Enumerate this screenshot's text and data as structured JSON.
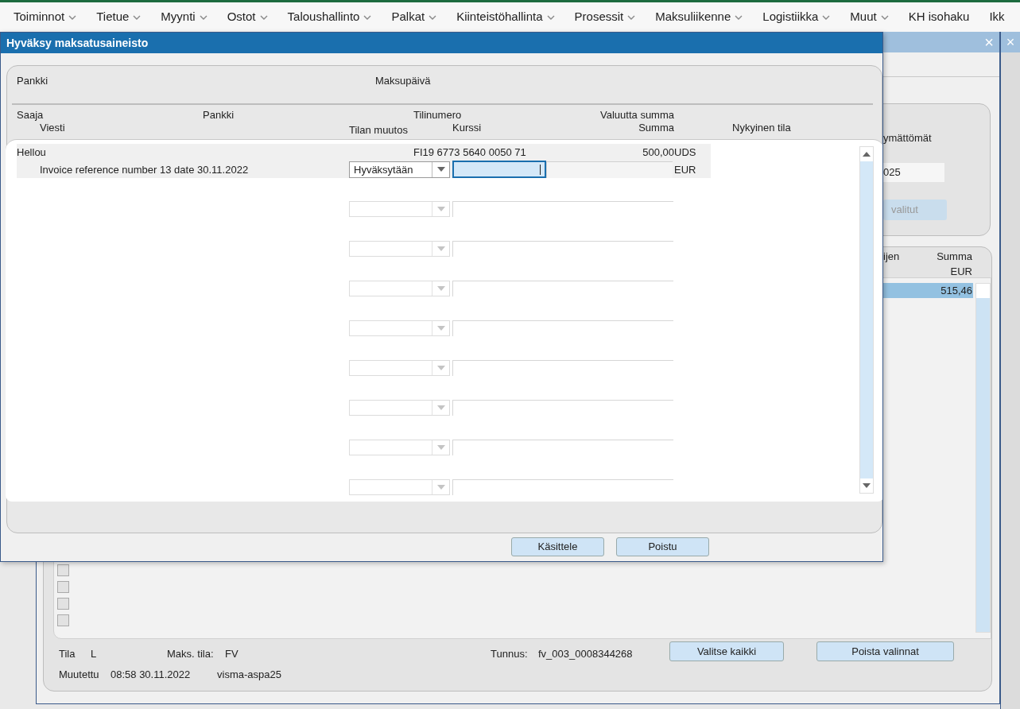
{
  "menu": [
    {
      "label": "Toiminnot",
      "has_dropdown": true
    },
    {
      "label": "Tietue",
      "has_dropdown": true
    },
    {
      "label": "Myynti",
      "has_dropdown": true
    },
    {
      "label": "Ostot",
      "has_dropdown": true
    },
    {
      "label": "Taloushallinto",
      "has_dropdown": true
    },
    {
      "label": "Palkat",
      "has_dropdown": true
    },
    {
      "label": "Kiinteistöhallinta",
      "has_dropdown": true
    },
    {
      "label": "Prosessit",
      "has_dropdown": true
    },
    {
      "label": "Maksuliikenne",
      "has_dropdown": true
    },
    {
      "label": "Logistiikka",
      "has_dropdown": true
    },
    {
      "label": "Muut",
      "has_dropdown": true
    },
    {
      "label": "KH isohaku",
      "has_dropdown": false
    },
    {
      "label": "Ikk",
      "has_dropdown": false
    }
  ],
  "side_window": {
    "close_label": "×"
  },
  "background_window": {
    "close_label": "×",
    "side_panel": {
      "label": "ymättömät",
      "field_value": "025",
      "button": {
        "label": "valitut",
        "disabled": true
      }
    },
    "list": {
      "columns": [
        {
          "label": "ijen"
        },
        {
          "label": "Summa",
          "unit": "EUR"
        }
      ],
      "rows": [
        {
          "summa": "515,46",
          "selected": true
        }
      ],
      "checkboxes": [
        {
          "checked": false
        },
        {
          "checked": false
        },
        {
          "checked": false
        },
        {
          "checked": false
        }
      ]
    },
    "footer": {
      "tila_label": "Tila",
      "tila": "L",
      "maks_tila_label": "Maks. tila:",
      "maks_tila": "FV",
      "tunnus_label": "Tunnus:",
      "tunnus": "fv_003_0008344268",
      "muutettu_label": "Muutettu",
      "muutettu": "08:58 30.11.2022",
      "user": "visma-aspa25"
    },
    "buttons": [
      {
        "label": "Valitse kaikki"
      },
      {
        "label": "Poista valinnat"
      }
    ]
  },
  "dialog": {
    "title": "Hyväksy maksatusaineisto",
    "header_labels": [
      "Pankki",
      "Maksupäivä"
    ],
    "columns": {
      "saaja": "Saaja",
      "pankki": "Pankki",
      "tilinumero": "Tilinumero",
      "valuutta_summa": "Valuutta summa",
      "viesti": "Viesti",
      "tilan_muutos": "Tilan muutos",
      "kurssi": "Kurssi",
      "summa": "Summa",
      "nykyinen_tila": "Nykyinen tila"
    },
    "rows": [
      {
        "kind": "entry",
        "saaja": "Hellou",
        "tilinumero": "FI19 6773 5640 0050 71",
        "valuutta_summa": "500,00",
        "valuutta": "UDS",
        "viesti": "Invoice reference number 13 date 30.11.2022",
        "tilan_muutos": "Hyväksytään",
        "kurssi_focused": true,
        "summa_valuutta": "EUR"
      },
      {
        "kind": "blank",
        "disabled": true
      },
      {
        "kind": "blank",
        "disabled": true
      },
      {
        "kind": "blank",
        "disabled": true
      },
      {
        "kind": "blank",
        "disabled": true
      },
      {
        "kind": "blank",
        "disabled": true
      },
      {
        "kind": "blank",
        "disabled": true
      },
      {
        "kind": "blank",
        "disabled": true
      },
      {
        "kind": "blank",
        "disabled": true
      }
    ],
    "buttons": [
      {
        "label": "Käsittele"
      },
      {
        "label": "Poistu"
      }
    ]
  }
}
